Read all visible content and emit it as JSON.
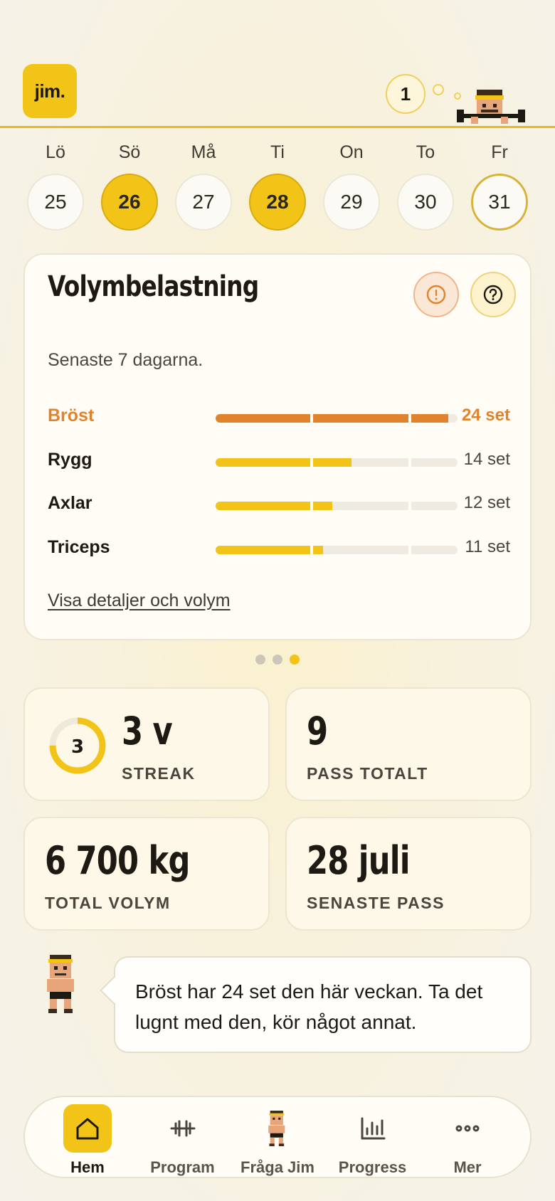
{
  "header": {
    "logo": "jim.",
    "counter": "1"
  },
  "days": [
    {
      "name": "Lö",
      "num": "25",
      "state": "normal"
    },
    {
      "name": "Sö",
      "num": "26",
      "state": "done"
    },
    {
      "name": "Må",
      "num": "27",
      "state": "normal"
    },
    {
      "name": "Ti",
      "num": "28",
      "state": "done"
    },
    {
      "name": "On",
      "num": "29",
      "state": "normal"
    },
    {
      "name": "To",
      "num": "30",
      "state": "normal"
    },
    {
      "name": "Fr",
      "num": "31",
      "state": "today"
    }
  ],
  "volume_card": {
    "title": "Volymbelastning",
    "subtitle": "Senaste 7 dagarna.",
    "link": "Visa detaljer och volym",
    "muscles": [
      {
        "name": "Bröst",
        "value": "24 set",
        "sets": 24,
        "over": true
      },
      {
        "name": "Rygg",
        "value": "14 set",
        "sets": 14,
        "over": false
      },
      {
        "name": "Axlar",
        "value": "12 set",
        "sets": 12,
        "over": false
      },
      {
        "name": "Triceps",
        "value": "11 set",
        "sets": 11,
        "over": false
      }
    ],
    "bar_colors": {
      "over": "#e0832c",
      "normal": "#f2c418"
    }
  },
  "pager": {
    "count": 3,
    "active": 2
  },
  "stats": {
    "streak": {
      "ring_number": "3",
      "value": "3 v",
      "label": "STREAK",
      "ring_fraction": 0.75
    },
    "sessions": {
      "value": "9",
      "label": "PASS TOTALT"
    },
    "volume": {
      "value": "6 700 kg",
      "label": "TOTAL VOLYM"
    },
    "last": {
      "value": "28 juli",
      "label": "SENASTE PASS"
    }
  },
  "coach_message": "Bröst har 24 set den här veckan. Ta det lugnt med den, kör något annat.",
  "nav": {
    "home": "Hem",
    "program": "Program",
    "ask": "Fråga Jim",
    "progress": "Progress",
    "more": "Mer"
  }
}
